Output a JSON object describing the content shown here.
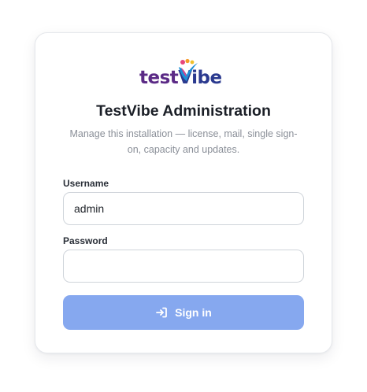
{
  "brand": {
    "logo_part1": "test",
    "logo_part2": "Vibe"
  },
  "header": {
    "title": "TestVibe Administration",
    "subtitle": "Manage this installation — license, mail, single sign-on, capacity and updates."
  },
  "form": {
    "username_label": "Username",
    "username_value": "admin",
    "password_label": "Password",
    "password_value": "",
    "signin_label": "Sign in",
    "signin_icon": "sign-in-icon"
  },
  "colors": {
    "button": "#86a8ef",
    "logo_purple": "#5b2a86",
    "logo_blue": "#2b3a8f"
  }
}
